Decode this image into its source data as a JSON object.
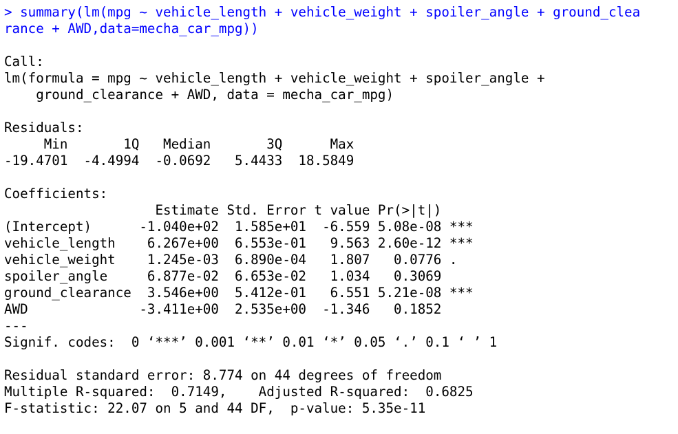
{
  "prompt": ">",
  "command_lines": [
    "> summary(lm(mpg ~ vehicle_length + vehicle_weight + spoiler_angle + ground_clea",
    "rance + AWD,data=mecha_car_mpg))"
  ],
  "call": {
    "header": "Call:",
    "lines": [
      "lm(formula = mpg ~ vehicle_length + vehicle_weight + spoiler_angle + ",
      "    ground_clearance + AWD, data = mecha_car_mpg)"
    ]
  },
  "residuals": {
    "header": "Residuals:",
    "columns_line": "     Min       1Q   Median       3Q      Max ",
    "values_line": "-19.4701  -4.4994  -0.0692   5.4433  18.5849 "
  },
  "coefficients": {
    "header": "Coefficients:",
    "columns_line": "                   Estimate Std. Error t value Pr(>|t|)    ",
    "rows": [
      "(Intercept)      -1.040e+02  1.585e+01  -6.559 5.08e-08 ***",
      "vehicle_length    6.267e+00  6.553e-01   9.563 2.60e-12 ***",
      "vehicle_weight    1.245e-03  6.890e-04   1.807   0.0776 .  ",
      "spoiler_angle     6.877e-02  6.653e-02   1.034   0.3069    ",
      "ground_clearance  3.546e+00  5.412e-01   6.551 5.21e-08 ***",
      "AWD              -3.411e+00  2.535e+00  -1.346   0.1852    "
    ],
    "separator": "---",
    "signif_line": "Signif. codes:  0 ‘***’ 0.001 ‘**’ 0.01 ‘*’ 0.05 ‘.’ 0.1 ‘ ’ 1"
  },
  "summary_lines": [
    "Residual standard error: 8.774 on 44 degrees of freedom",
    "Multiple R-squared:  0.7149,\tAdjusted R-squared:  0.6825 ",
    "F-statistic: 22.07 on 5 and 44 DF,  p-value: 5.35e-11"
  ]
}
